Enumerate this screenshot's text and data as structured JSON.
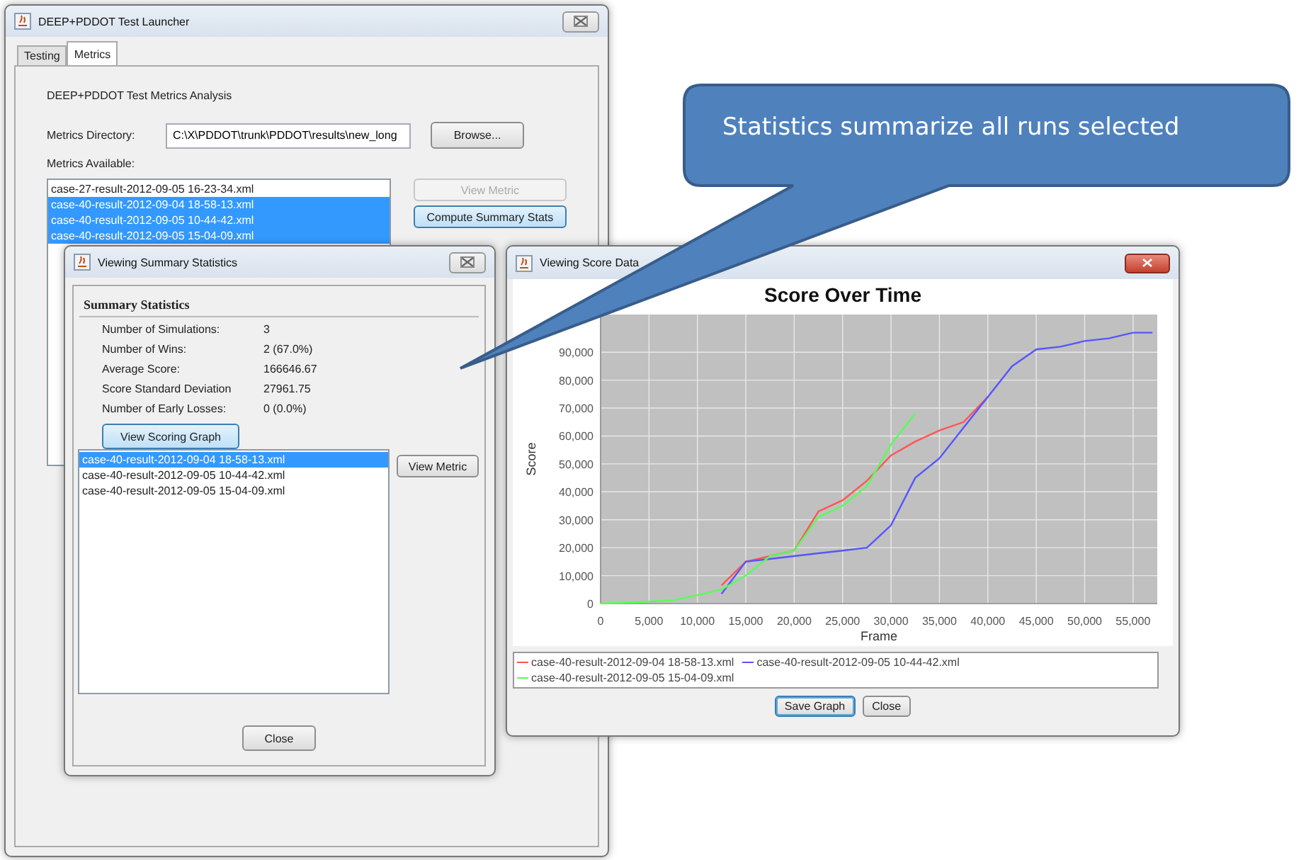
{
  "launcher": {
    "title": "DEEP+PDDOT Test Launcher",
    "tabs": [
      {
        "label": "Testing",
        "selected": false
      },
      {
        "label": "Metrics",
        "selected": true
      }
    ],
    "heading": "DEEP+PDDOT Test Metrics Analysis",
    "directory": {
      "label": "Metrics Directory:",
      "value": "C:\\X\\PDDOT\\trunk\\PDDOT\\results\\new_long"
    },
    "browse_button": "Browse...",
    "available_label": "Metrics Available:",
    "files": [
      {
        "name": "case-27-result-2012-09-05 16-23-34.xml",
        "selected": false
      },
      {
        "name": "case-40-result-2012-09-04 18-58-13.xml",
        "selected": true
      },
      {
        "name": "case-40-result-2012-09-05 10-44-42.xml",
        "selected": true
      },
      {
        "name": "case-40-result-2012-09-05 15-04-09.xml",
        "selected": true
      }
    ],
    "buttons": [
      {
        "label": "View Metric",
        "disabled": true
      },
      {
        "label": "Compute Summary Stats",
        "disabled": false
      }
    ]
  },
  "summary_window": {
    "title": "Viewing Summary Statistics",
    "heading": "Summary Statistics",
    "stats": [
      {
        "label": "Number of Simulations:",
        "value": "3"
      },
      {
        "label": "Number of Wins:",
        "value": "2 (67.0%)"
      },
      {
        "label": "Average Score:",
        "value": "166646.67"
      },
      {
        "label": "Score Standard Deviation",
        "value": "27961.75"
      },
      {
        "label": "Number of Early Losses:",
        "value": "0 (0.0%)"
      }
    ],
    "graph_button": "View Scoring Graph",
    "files": [
      {
        "name": "case-40-result-2012-09-04 18-58-13.xml",
        "selected": true
      },
      {
        "name": "case-40-result-2012-09-05 10-44-42.xml",
        "selected": false
      },
      {
        "name": "case-40-result-2012-09-05 15-04-09.xml",
        "selected": false
      }
    ],
    "view_button": "View Metric",
    "close_button": "Close"
  },
  "score_window": {
    "title": "Viewing Score Data",
    "chart_data": {
      "type": "line",
      "title": "Score Over Time",
      "xlabel": "Frame",
      "ylabel": "Score",
      "x": [
        0,
        2500,
        5000,
        7500,
        10000,
        12500,
        15000,
        17500,
        20000,
        22500,
        25000,
        27500,
        30000,
        32500,
        35000,
        37500,
        40000,
        42500,
        45000,
        47500,
        50000,
        52500,
        55000,
        57000
      ],
      "grid": true,
      "series": [
        {
          "name": "case-40-result-2012-09-04 18-58-13.xml",
          "color": "#ff5555",
          "values": [
            null,
            null,
            null,
            null,
            null,
            6500,
            15000,
            17000,
            19000,
            33000,
            37000,
            44000,
            53000,
            58000,
            62000,
            65000,
            74000,
            null,
            null,
            null,
            null,
            null,
            null,
            null
          ]
        },
        {
          "name": "case-40-result-2012-09-05 10-44-42.xml",
          "color": "#5555ff",
          "values": [
            null,
            null,
            null,
            null,
            null,
            3500,
            15000,
            16000,
            17000,
            18000,
            19000,
            20000,
            28000,
            45000,
            52000,
            63000,
            74000,
            85000,
            91000,
            92000,
            94000,
            95000,
            97000,
            97000
          ]
        },
        {
          "name": "case-40-result-2012-09-05 15-04-09.xml",
          "color": "#55ff55",
          "values": [
            0,
            300,
            700,
            1200,
            3000,
            5000,
            10000,
            17000,
            19000,
            31000,
            35000,
            42000,
            57000,
            68000,
            null,
            null,
            null,
            null,
            null,
            null,
            null,
            null,
            null,
            null
          ]
        }
      ],
      "xlim": [
        0,
        57500
      ],
      "ylim": [
        0,
        103500
      ],
      "xticks": [
        {
          "value": 0,
          "label": "0"
        },
        {
          "value": 5000,
          "label": "5,000"
        },
        {
          "value": 10000,
          "label": "10,000"
        },
        {
          "value": 15000,
          "label": "15,000"
        },
        {
          "value": 20000,
          "label": "20,000"
        },
        {
          "value": 25000,
          "label": "25,000"
        },
        {
          "value": 30000,
          "label": "30,000"
        },
        {
          "value": 35000,
          "label": "35,000"
        },
        {
          "value": 40000,
          "label": "40,000"
        },
        {
          "value": 45000,
          "label": "45,000"
        },
        {
          "value": 50000,
          "label": "50,000"
        },
        {
          "value": 55000,
          "label": "55,000"
        }
      ],
      "yticks": [
        {
          "value": 0,
          "label": "0"
        },
        {
          "value": 10000,
          "label": "10,000"
        },
        {
          "value": 20000,
          "label": "20,000"
        },
        {
          "value": 30000,
          "label": "30,000"
        },
        {
          "value": 40000,
          "label": "40,000"
        },
        {
          "value": 50000,
          "label": "50,000"
        },
        {
          "value": 60000,
          "label": "60,000"
        },
        {
          "value": 70000,
          "label": "70,000"
        },
        {
          "value": 80000,
          "label": "80,000"
        },
        {
          "value": 90000,
          "label": "90,000"
        }
      ]
    },
    "buttons": [
      {
        "label": "Save Graph",
        "focused": true
      },
      {
        "label": "Close",
        "focused": false
      }
    ]
  },
  "callout": {
    "text": "Statistics summarize all runs selected"
  }
}
